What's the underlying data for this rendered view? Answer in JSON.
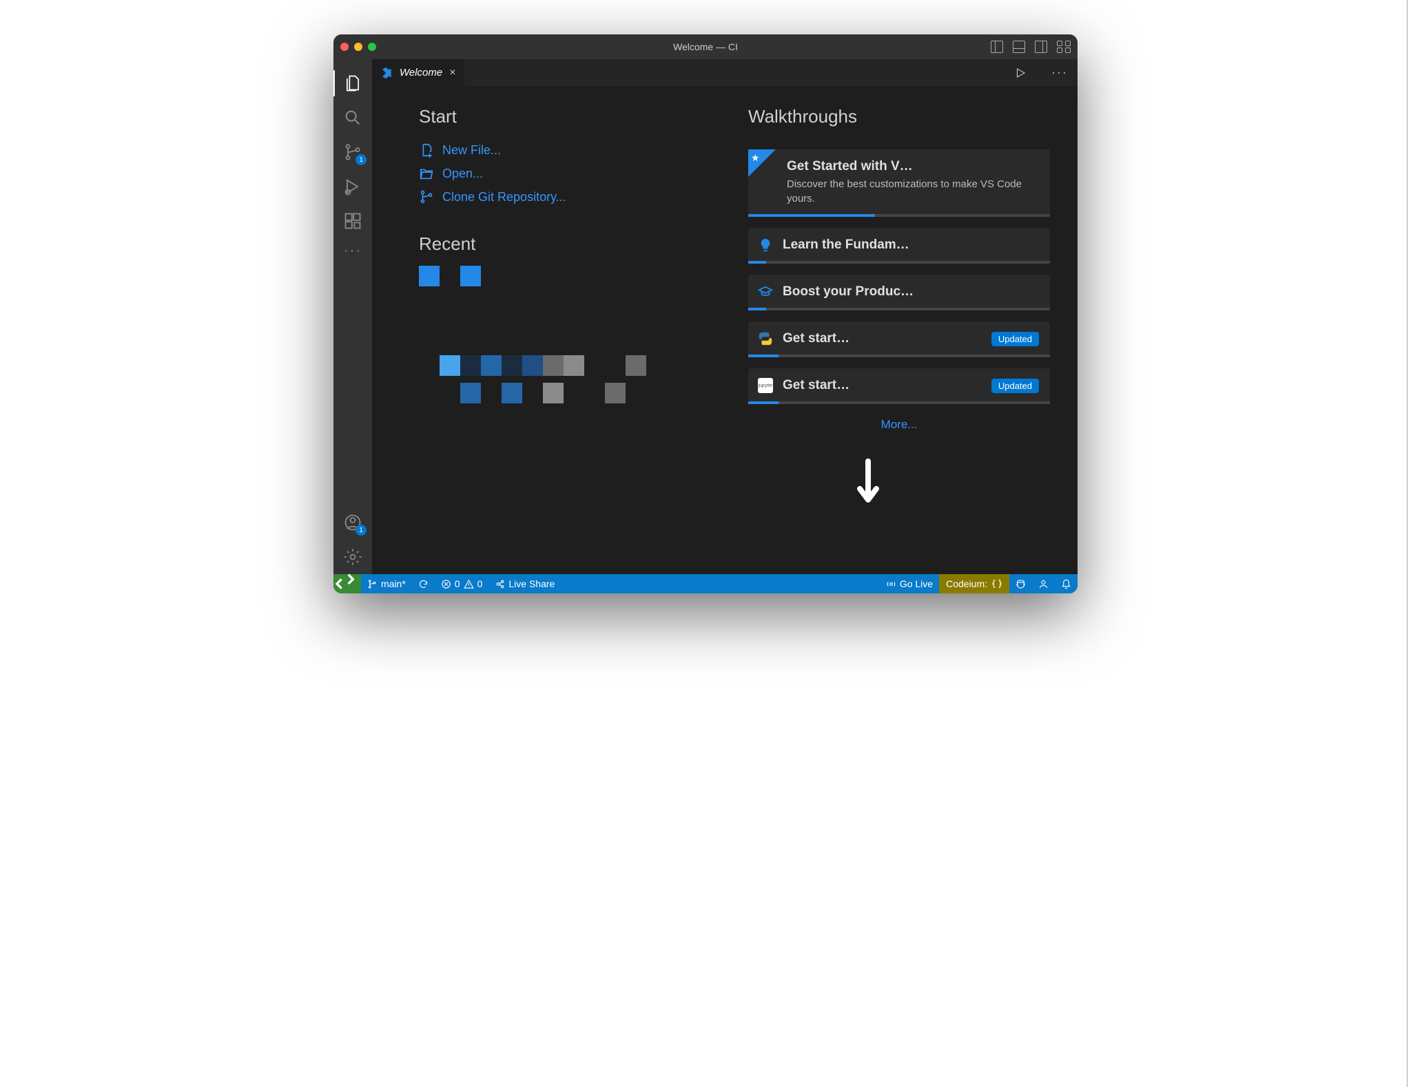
{
  "titlebar": {
    "title": "Welcome — CI"
  },
  "activitybar": {
    "scm_badge": "1",
    "accounts_badge": "1"
  },
  "tab": {
    "label": "Welcome"
  },
  "welcome": {
    "start_heading": "Start",
    "links": {
      "new_file": "New File...",
      "open": "Open...",
      "clone": "Clone Git Repository..."
    },
    "recent_heading": "Recent",
    "walkthroughs_heading": "Walkthroughs",
    "cards": {
      "vscode": {
        "title": "Get Started with V…",
        "desc": "Discover the best customizations to make VS Code yours."
      },
      "fundamentals": {
        "title": "Learn the Fundam…"
      },
      "productivity": {
        "title": "Boost your Produc…"
      },
      "python": {
        "title": "Get start…",
        "badge": "Updated"
      },
      "jupyter": {
        "title": "Get start…",
        "badge": "Updated"
      }
    },
    "more": "More..."
  },
  "statusbar": {
    "branch": "main*",
    "errors": "0",
    "warnings": "0",
    "liveshare": "Live Share",
    "golive": "Go Live",
    "codeium": "Codeium:"
  }
}
